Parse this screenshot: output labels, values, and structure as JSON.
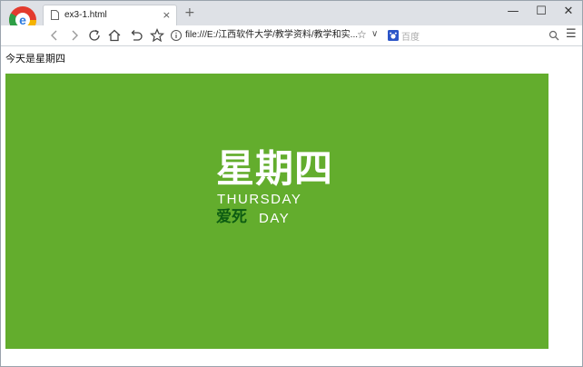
{
  "tab": {
    "title": "ex3-1.html",
    "close": "×",
    "new_tab": "+"
  },
  "window": {
    "minimize": "—",
    "maximize": "☐",
    "close": "✕"
  },
  "toolbar": {
    "address": "file:///E:/江西软件大学/教学资料/教学和实...",
    "search_placeholder": "百度",
    "star": "☆",
    "dropdown": "∨",
    "menu": "☰"
  },
  "content": {
    "caption": "今天是星期四",
    "banner": {
      "big_text": "星期四",
      "english_line": "THURSDAY",
      "chinese_small": "爱死",
      "english_small": "DAY"
    }
  },
  "colors": {
    "banner_bg": "#63ad2d",
    "accent_dark": "#0d5c12"
  }
}
